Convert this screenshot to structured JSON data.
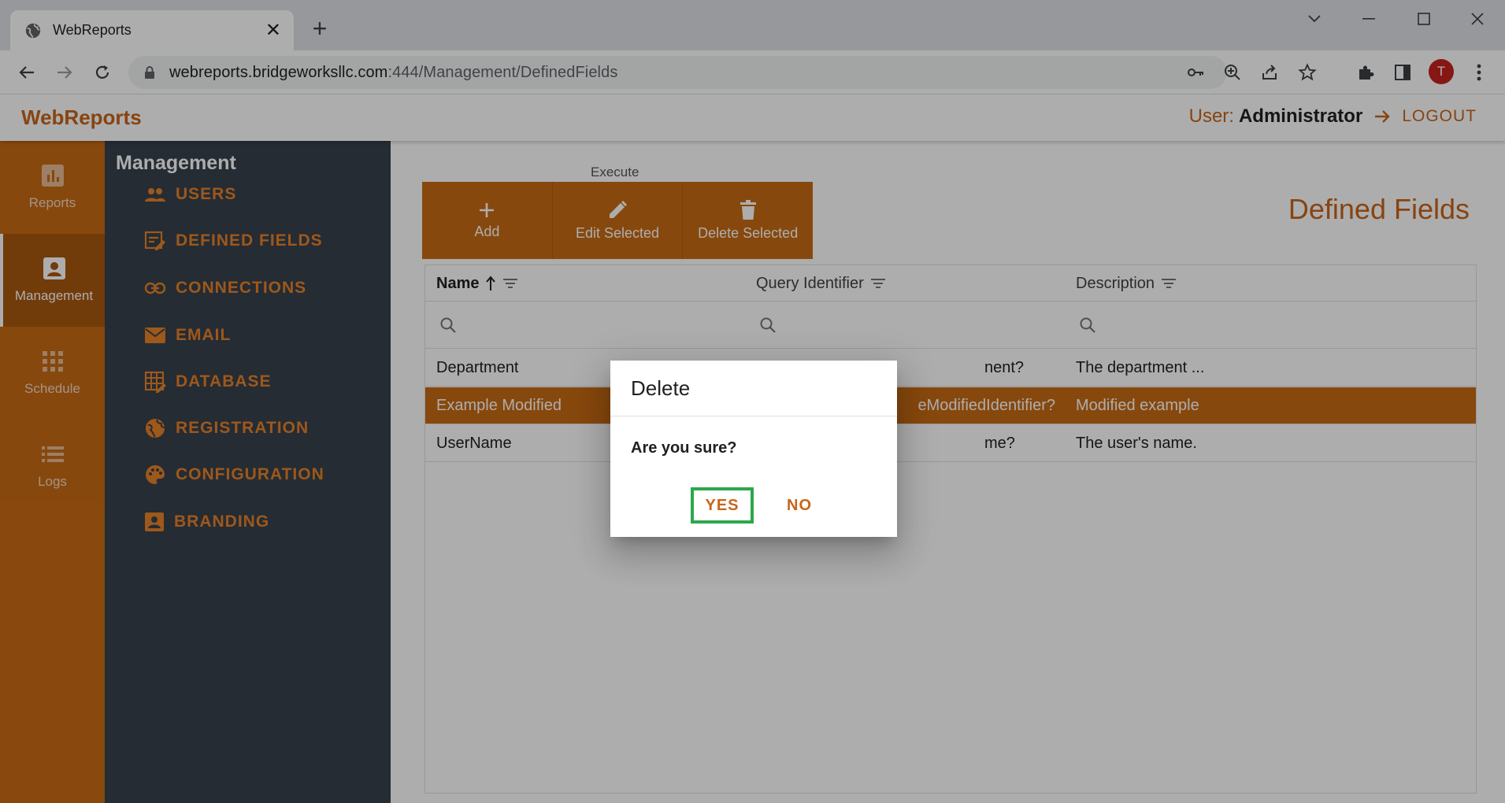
{
  "browser": {
    "tab_title": "WebReports",
    "url_host": "webreports.bridgeworksllc.com",
    "url_rest": ":444/Management/DefinedFields",
    "profile_initial": "T",
    "icons": [
      "globe-icon",
      "close-icon",
      "plus-icon",
      "chevron-down-icon",
      "minimize-icon",
      "maximize-icon",
      "close-window-icon",
      "back-arrow-icon",
      "forward-arrow-icon",
      "reload-icon",
      "lock-icon",
      "key-icon",
      "zoom-icon",
      "share-icon",
      "star-icon",
      "extensions-icon",
      "side-panel-icon",
      "kebab-menu-icon"
    ]
  },
  "app": {
    "brand": "WebReports",
    "user_prefix": "User:",
    "user_name": "Administrator",
    "logout_label": "LOGOUT",
    "accent_color": "#c8651a"
  },
  "rail": {
    "items": [
      {
        "label": "Reports",
        "icon": "bar-chart-icon"
      },
      {
        "label": "Management",
        "icon": "person-badge-icon"
      },
      {
        "label": "Schedule",
        "icon": "grid-dots-icon"
      },
      {
        "label": "Logs",
        "icon": "list-icon"
      }
    ],
    "active": "Management"
  },
  "submenu": {
    "title": "Management",
    "items": [
      {
        "label": "USERS",
        "icon": "people-icon"
      },
      {
        "label": "DEFINED FIELDS",
        "icon": "form-edit-icon"
      },
      {
        "label": "CONNECTIONS",
        "icon": "link-icon"
      },
      {
        "label": "EMAIL",
        "icon": "envelope-icon"
      },
      {
        "label": "DATABASE",
        "icon": "table-edit-icon"
      },
      {
        "label": "REGISTRATION",
        "icon": "globe-icon"
      },
      {
        "label": "CONFIGURATION",
        "icon": "palette-icon"
      },
      {
        "label": "BRANDING",
        "icon": "badge-icon"
      }
    ]
  },
  "content": {
    "execute_label": "Execute",
    "actions": {
      "add": "Add",
      "edit": "Edit Selected",
      "delete": "Delete Selected"
    },
    "page_title": "Defined Fields"
  },
  "grid": {
    "columns": [
      "Name",
      "Query Identifier",
      "Description"
    ],
    "sorted_column": "Name",
    "rows": [
      {
        "name": "Department",
        "query": "nent?",
        "description": "The department ..."
      },
      {
        "name": "Example Modified",
        "query": "eModifiedIdentifier?",
        "description": "Modified example"
      },
      {
        "name": "UserName",
        "query": "me?",
        "description": "The user's name."
      }
    ],
    "selected_row": 1
  },
  "dialog": {
    "title": "Delete",
    "message": "Are you sure?",
    "yes_label": "YES",
    "no_label": "NO",
    "highlight_color": "#2ca84a"
  }
}
